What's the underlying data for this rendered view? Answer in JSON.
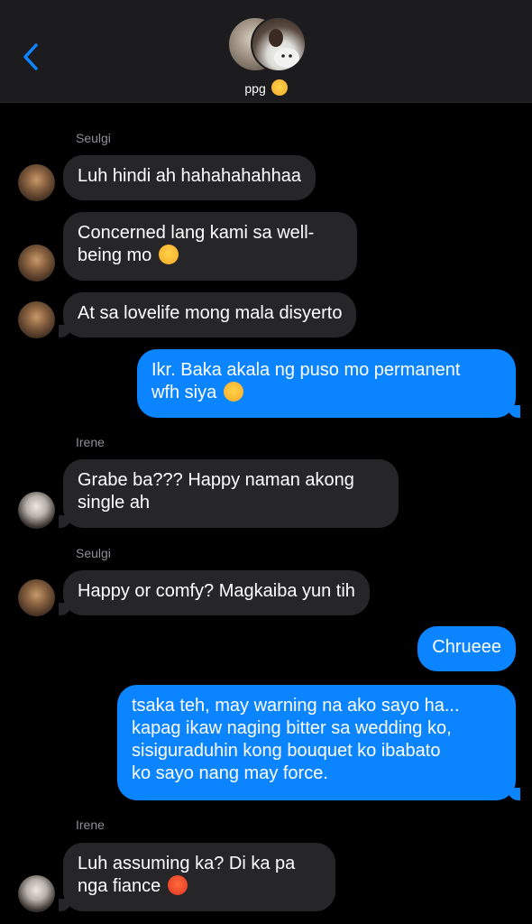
{
  "header": {
    "title": "ppg",
    "title_emoji": "smiling-face-with-hearts-icon",
    "back_icon": "chevron-left-icon",
    "accent": "#0a84ff"
  },
  "messages": [
    {
      "type": "sender",
      "text": "Seulgi"
    },
    {
      "type": "in",
      "text": "Luh hindi ah hahahahahhaa",
      "avatar": "seulgi"
    },
    {
      "type": "in",
      "text": "Concerned lang kami sa well-",
      "text2": "being mo",
      "emoji": "smiling-face-with-hearts-icon",
      "avatar": "seulgi"
    },
    {
      "type": "in",
      "text": "At sa lovelife mong mala disyerto",
      "avatar": "seulgi"
    },
    {
      "type": "out",
      "text": "Ikr. Baka akala ng puso mo permanent",
      "text2": "wfh siya",
      "emoji": "crying-face-icon"
    },
    {
      "type": "sender",
      "text": "Irene"
    },
    {
      "type": "in",
      "text": "Grabe ba??? Happy naman akong",
      "text2": "single ah",
      "avatar": "irene"
    },
    {
      "type": "sender",
      "text": "Seulgi"
    },
    {
      "type": "in",
      "text": "Happy or comfy? Magkaiba yun tih",
      "avatar": "seulgi"
    },
    {
      "type": "out",
      "text": "Chrueee"
    },
    {
      "type": "out",
      "text": "tsaka teh, may warning na ako sayo ha...",
      "text2": "kapag ikaw naging bitter sa wedding ko,",
      "text3": "sisiguraduhin kong bouquet ko ibabato",
      "text4": "ko sayo nang may force."
    },
    {
      "type": "sender",
      "text": "Irene"
    },
    {
      "type": "in",
      "text": "Luh assuming ka? Di ka pa",
      "text2": "nga fiance",
      "emoji": "pouting-face-icon",
      "avatar": "irene"
    }
  ],
  "colors": {
    "incoming_bubble": "#262628",
    "outgoing_bubble": "#0a84ff",
    "sender_label": "#8e8e93",
    "background": "#000000"
  }
}
